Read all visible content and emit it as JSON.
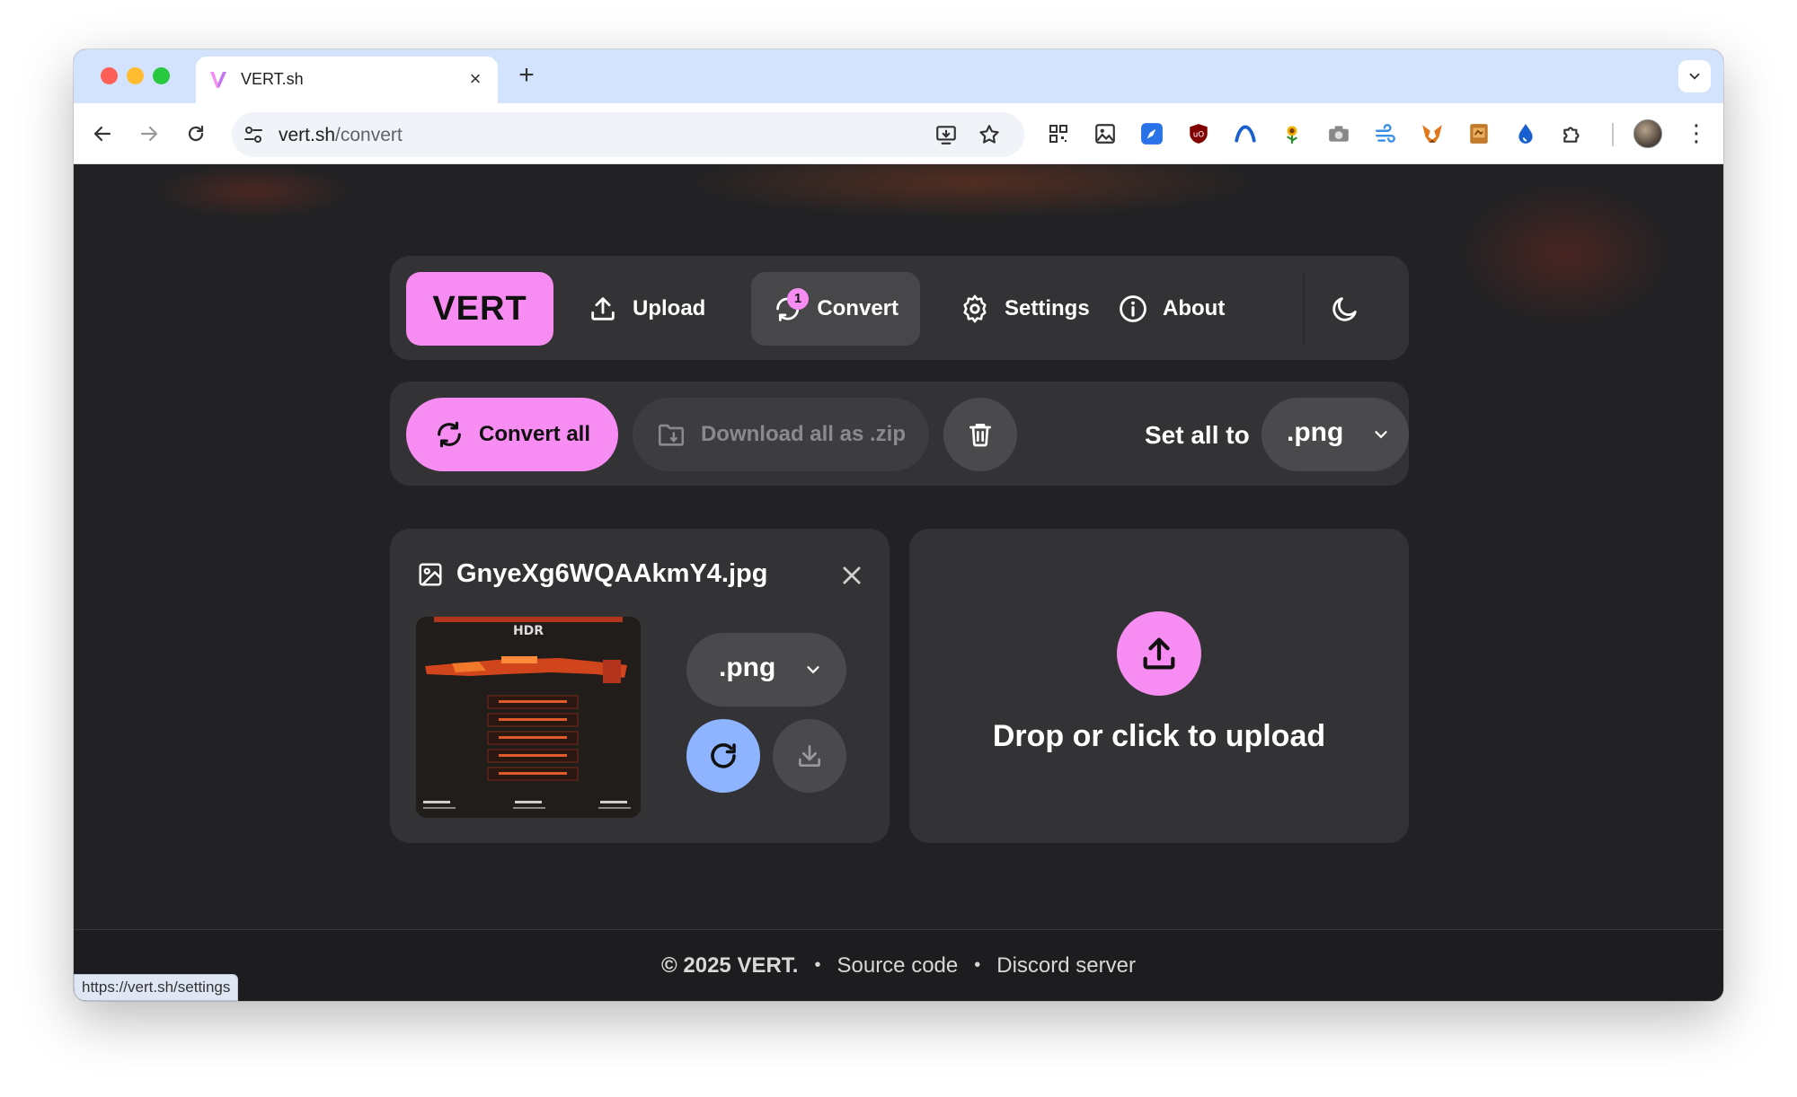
{
  "browser": {
    "tab_title": "VERT.sh",
    "tab_close": "×",
    "new_tab": "+",
    "url_host": "vert.sh",
    "url_path": "/convert",
    "menu_glyph": "⋮",
    "status_url": "https://vert.sh/settings"
  },
  "nav": {
    "logo": "VERT",
    "upload": "Upload",
    "convert": "Convert",
    "convert_badge": "1",
    "settings": "Settings",
    "about": "About"
  },
  "actions": {
    "convert_all": "Convert all",
    "download_zip": "Download all as .zip",
    "set_all_label": "Set all to",
    "set_all_value": ".png"
  },
  "file": {
    "name": "GnyeXg6WQAAkmY4.jpg",
    "thumb_label": "HDR",
    "format": ".png"
  },
  "dropzone": {
    "text": "Drop or click to upload"
  },
  "footer": {
    "copyright": "© 2025 VERT.",
    "sep1": "•",
    "source": "Source code",
    "sep2": "•",
    "discord": "Discord server"
  },
  "colors": {
    "accent_pink": "#f78cf2",
    "accent_blue": "#8eb3ff",
    "panel": "#333335",
    "page_bg": "#222224"
  }
}
